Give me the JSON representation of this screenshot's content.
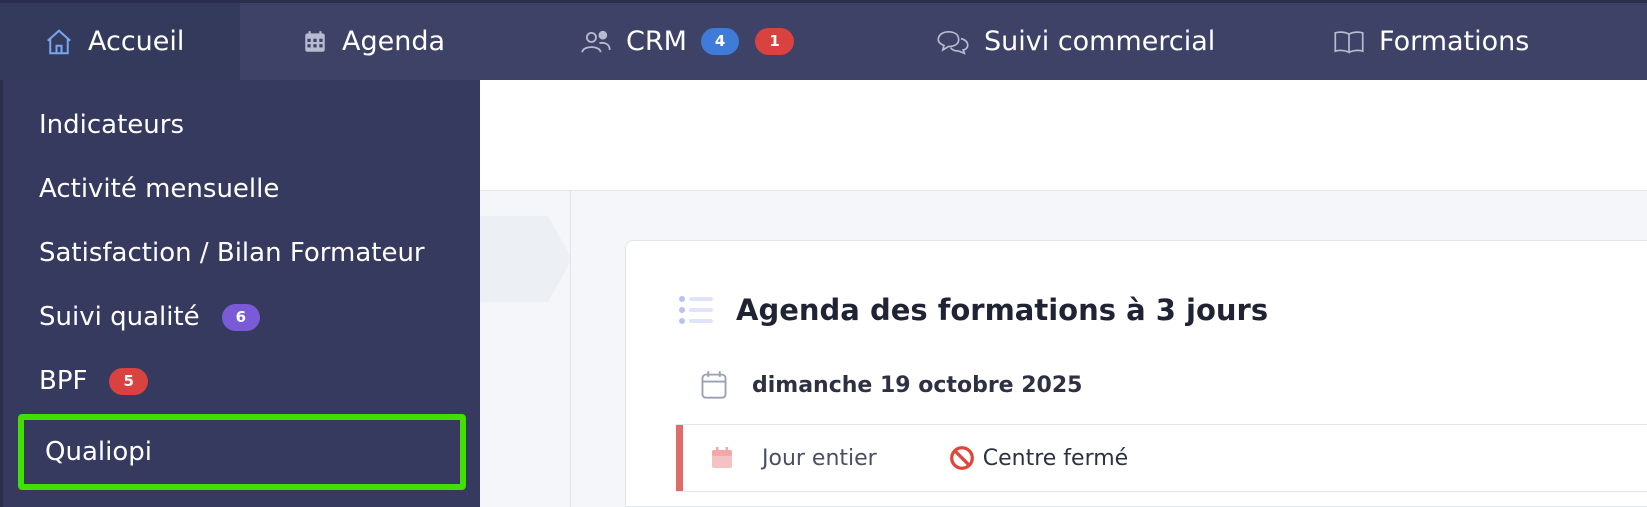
{
  "nav": {
    "items": [
      {
        "label": "Accueil",
        "icon": "home-icon",
        "active": true
      },
      {
        "label": "Agenda",
        "icon": "calendar-icon"
      },
      {
        "label": "CRM",
        "icon": "users-icon",
        "badges": [
          "4",
          "1"
        ]
      },
      {
        "label": "Suivi commercial",
        "icon": "chat-icon"
      },
      {
        "label": "Formations",
        "icon": "book-icon"
      }
    ]
  },
  "dropdown": {
    "items": [
      {
        "label": "Indicateurs"
      },
      {
        "label": "Activité mensuelle"
      },
      {
        "label": "Satisfaction / Bilan Formateur"
      },
      {
        "label": "Suivi qualité",
        "badge": "6"
      },
      {
        "label": "BPF",
        "badge": "5"
      },
      {
        "label": "Qualiopi",
        "highlighted": true
      }
    ]
  },
  "panel": {
    "title": "Agenda des formations à 3 jours",
    "date": "dimanche 19 octobre 2025",
    "event": {
      "time": "Jour entier",
      "status": "Centre fermé"
    }
  },
  "colors": {
    "nav_bg": "#3d4266",
    "dropdown_bg": "#353a5e",
    "badge_blue": "#3f7bd9",
    "badge_red": "#d9423f",
    "badge_purple": "#7a5ad6",
    "highlight": "#41e000",
    "event_bar": "#e06b6b"
  }
}
